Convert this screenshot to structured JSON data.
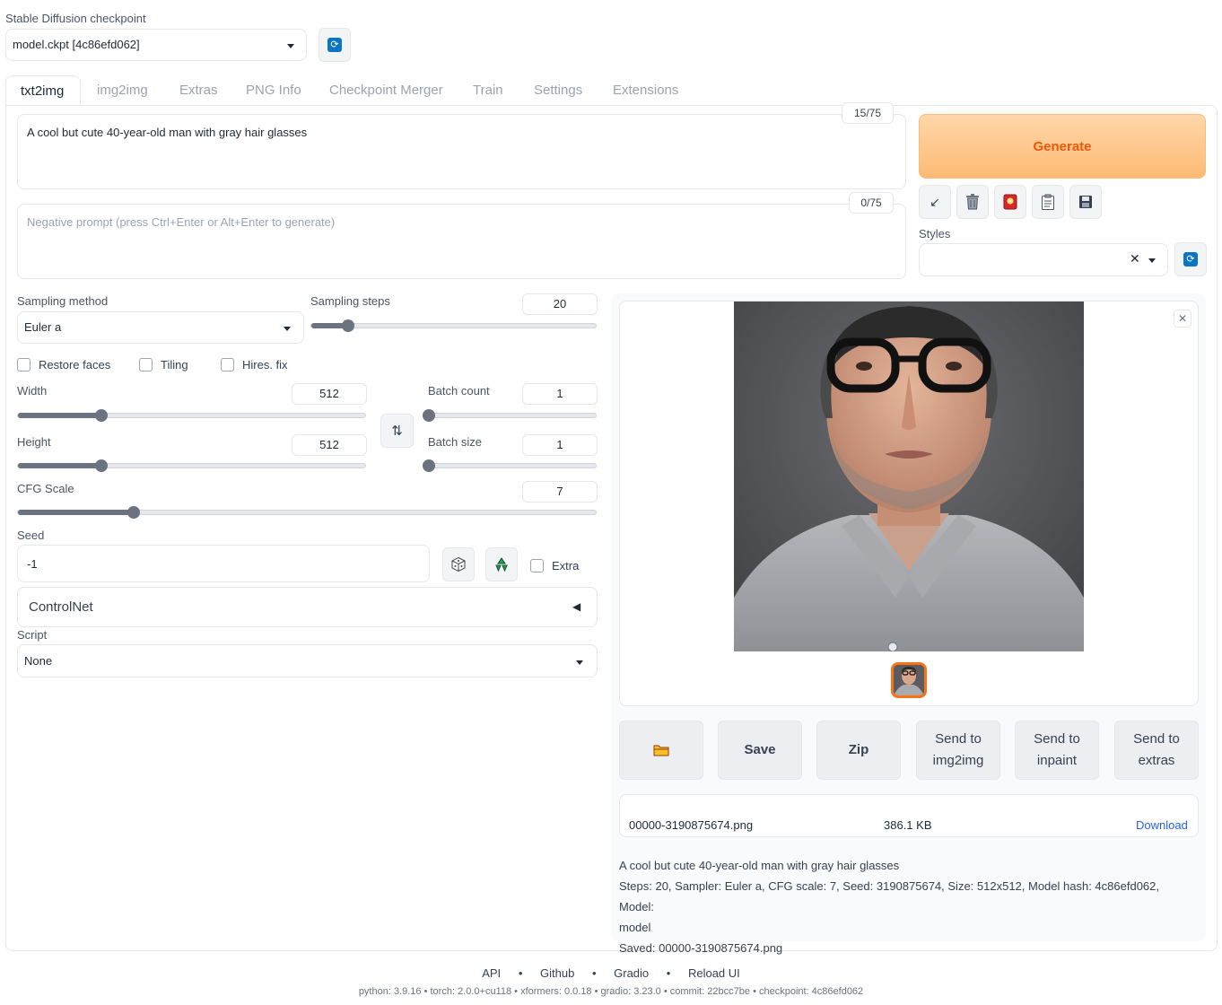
{
  "checkpoint": {
    "label": "Stable Diffusion checkpoint",
    "value": "model.ckpt [4c86efd062]"
  },
  "tabs": [
    "txt2img",
    "img2img",
    "Extras",
    "PNG Info",
    "Checkpoint Merger",
    "Train",
    "Settings",
    "Extensions"
  ],
  "prompt": {
    "value": "A cool but cute 40-year-old man with gray hair glasses",
    "counter": "15/75"
  },
  "negative_prompt": {
    "placeholder": "Negative prompt (press Ctrl+Enter or Alt+Enter to generate)",
    "counter": "0/75"
  },
  "generate_label": "Generate",
  "styles_label": "Styles",
  "sampling": {
    "method_label": "Sampling method",
    "method_value": "Euler a",
    "steps_label": "Sampling steps",
    "steps_value": "20"
  },
  "checkboxes": {
    "restore_faces": "Restore faces",
    "tiling": "Tiling",
    "hires_fix": "Hires. fix"
  },
  "width": {
    "label": "Width",
    "value": "512"
  },
  "height": {
    "label": "Height",
    "value": "512"
  },
  "batch_count": {
    "label": "Batch count",
    "value": "1"
  },
  "batch_size": {
    "label": "Batch size",
    "value": "1"
  },
  "cfg_scale": {
    "label": "CFG Scale",
    "value": "7"
  },
  "seed": {
    "label": "Seed",
    "value": "-1",
    "extra_label": "Extra"
  },
  "controlnet_label": "ControlNet",
  "script": {
    "label": "Script",
    "value": "None"
  },
  "output_buttons": {
    "save": "Save",
    "zip": "Zip",
    "send_img2img_1": "Send to",
    "send_img2img_2": "img2img",
    "send_inpaint_1": "Send to",
    "send_inpaint_2": "inpaint",
    "send_extras_1": "Send to",
    "send_extras_2": "extras"
  },
  "file": {
    "name": "00000-3190875674.png",
    "size": "386.1 KB",
    "download": "Download"
  },
  "info": {
    "line1": "A cool but cute 40-year-old man with gray hair glasses",
    "line2": "Steps: 20, Sampler: Euler a, CFG scale: 7, Seed: 3190875674, Size: 512x512, Model hash: 4c86efd062, Model:",
    "line3": "model",
    "line4": "Saved: 00000-3190875674.png"
  },
  "footer": {
    "links": [
      "API",
      "Github",
      "Gradio",
      "Reload UI"
    ],
    "versions": "python: 3.9.16  •  torch: 2.0.0+cu118  •  xformers: 0.0.18  •  gradio: 3.23.0  •  commit: 22bcc7be  •  checkpoint: 4c86efd062"
  },
  "slider_levels": {
    "sampling_steps": 0.13,
    "width": 0.24,
    "height": 0.24,
    "batch_count": 0.0,
    "batch_size": 0.0,
    "cfg_scale": 0.2
  },
  "colors": {
    "accent": "#f97316",
    "generate_bg": "#fdc89a",
    "link": "#2563eb",
    "icon_blue": "#0b74c4"
  }
}
